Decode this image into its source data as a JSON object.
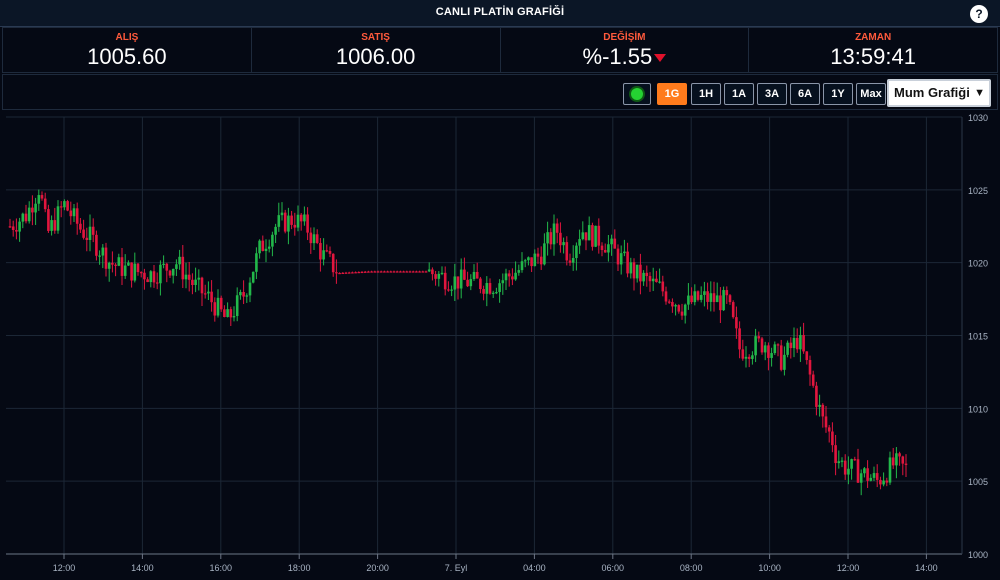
{
  "header": {
    "title": "CANLI PLATİN GRAFİĞİ",
    "help_label": "?"
  },
  "stats": [
    {
      "label": "ALIŞ",
      "value": "1005.60"
    },
    {
      "label": "SATIŞ",
      "value": "1006.00"
    },
    {
      "label": "DEĞİŞİM",
      "value": "%-1.55"
    },
    {
      "label": "ZAMAN",
      "value": "13:59:41"
    }
  ],
  "toolbar": {
    "ranges": [
      "1G",
      "1H",
      "1A",
      "3A",
      "6A",
      "1Y",
      "Max"
    ],
    "active_range": "1G",
    "chart_type": "Mum Grafiği"
  },
  "colors": {
    "up": "#22b84a",
    "down": "#e2163e",
    "accent": "#ff7b1c",
    "label": "#ff5a3c"
  },
  "chart_data": {
    "type": "candlestick",
    "x_ticks": [
      "12:00",
      "14:00",
      "16:00",
      "18:00",
      "20:00",
      "7. Eyl",
      "04:00",
      "06:00",
      "08:00",
      "10:00",
      "12:00",
      "14:00"
    ],
    "y_ticks": [
      1000,
      1005,
      1010,
      1015,
      1020,
      1025,
      1030
    ],
    "ylim": [
      1000,
      1030
    ],
    "grid": true,
    "close_path": [
      [
        0,
        1022.5
      ],
      [
        0.02,
        1023.3
      ],
      [
        0.035,
        1025.2
      ],
      [
        0.045,
        1022.0
      ],
      [
        0.065,
        1024.0
      ],
      [
        0.085,
        1022.3
      ],
      [
        0.1,
        1021.5
      ],
      [
        0.12,
        1020.0
      ],
      [
        0.14,
        1019.5
      ],
      [
        0.17,
        1019.2
      ],
      [
        0.2,
        1020.0
      ],
      [
        0.22,
        1018.5
      ],
      [
        0.24,
        1017.5
      ],
      [
        0.26,
        1016.0
      ],
      [
        0.28,
        1017.8
      ],
      [
        0.3,
        1021.0
      ],
      [
        0.32,
        1022.6
      ],
      [
        0.34,
        1023.0
      ],
      [
        0.355,
        1022.5
      ],
      [
        0.375,
        1020.5
      ],
      [
        0.395,
        1019.3
      ],
      [
        0.43,
        1019.4
      ],
      [
        0.5,
        1019.4
      ],
      [
        0.53,
        1018.8
      ],
      [
        0.58,
        1018.5
      ],
      [
        0.61,
        1019.5
      ],
      [
        0.635,
        1020.5
      ],
      [
        0.655,
        1022.3
      ],
      [
        0.67,
        1020.5
      ],
      [
        0.685,
        1022.3
      ],
      [
        0.715,
        1021.3
      ],
      [
        0.75,
        1019.2
      ],
      [
        0.78,
        1018.2
      ],
      [
        0.805,
        1017.0
      ],
      [
        0.83,
        1017.6
      ],
      [
        0.86,
        1017.3
      ],
      [
        0.875,
        1014.0
      ],
      [
        0.905,
        1014.5
      ],
      [
        0.925,
        1013.3
      ],
      [
        0.945,
        1014.8
      ],
      [
        0.96,
        1012.0
      ],
      [
        0.975,
        1009.0
      ],
      [
        0.985,
        1008.0
      ],
      [
        0.99,
        1006.8
      ],
      [
        1.0,
        1006.0
      ],
      [
        1.02,
        1005.6
      ],
      [
        1.04,
        1005.0
      ],
      [
        1.06,
        1006.2
      ],
      [
        1.075,
        1005.8
      ]
    ]
  }
}
